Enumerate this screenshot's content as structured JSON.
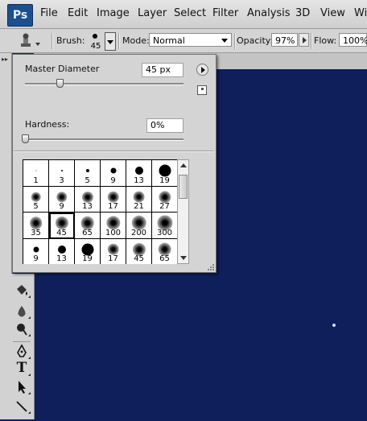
{
  "menubar": {
    "logo": "Ps",
    "items": [
      "File",
      "Edit",
      "Image",
      "Layer",
      "Select",
      "Filter",
      "Analysis",
      "3D",
      "View",
      "Wi"
    ]
  },
  "options_bar": {
    "brush_label": "Brush:",
    "brush_size": "45",
    "mode_label": "Mode:",
    "mode_value": "Normal",
    "opacity_label": "Opacity:",
    "opacity_value": "97%",
    "flow_label": "Flow:",
    "flow_value": "100%"
  },
  "brush_panel": {
    "master_diameter_label": "Master Diameter",
    "master_diameter_value": "45 px",
    "master_diameter_fraction": 0.22,
    "hardness_label": "Hardness:",
    "hardness_value": "0%",
    "hardness_fraction": 0.0,
    "selected_brush": "45",
    "presets": [
      {
        "size": "1",
        "style": "hard"
      },
      {
        "size": "3",
        "style": "hard"
      },
      {
        "size": "5",
        "style": "hard"
      },
      {
        "size": "9",
        "style": "hard"
      },
      {
        "size": "13",
        "style": "hard"
      },
      {
        "size": "19",
        "style": "hard"
      },
      {
        "size": "5",
        "style": "soft"
      },
      {
        "size": "9",
        "style": "soft"
      },
      {
        "size": "13",
        "style": "soft"
      },
      {
        "size": "17",
        "style": "soft"
      },
      {
        "size": "21",
        "style": "soft"
      },
      {
        "size": "27",
        "style": "soft"
      },
      {
        "size": "35",
        "style": "soft"
      },
      {
        "size": "45",
        "style": "soft"
      },
      {
        "size": "65",
        "style": "soft"
      },
      {
        "size": "100",
        "style": "soft"
      },
      {
        "size": "200",
        "style": "soft"
      },
      {
        "size": "300",
        "style": "soft"
      },
      {
        "size": "9",
        "style": "hard"
      },
      {
        "size": "13",
        "style": "hard"
      },
      {
        "size": "19",
        "style": "hard"
      },
      {
        "size": "17",
        "style": "soft"
      },
      {
        "size": "45",
        "style": "soft"
      },
      {
        "size": "65",
        "style": "soft"
      }
    ]
  },
  "tools": {
    "icons": [
      "paint-bucket-icon",
      "blur-drop-icon",
      "dodge-icon",
      "pen-tool-icon",
      "type-tool-icon",
      "path-selection-icon",
      "line-tool-icon"
    ],
    "type_glyph": "T"
  },
  "colors": {
    "canvas": "#0e1f5c",
    "ui_gray": "#d4d4d4",
    "ps_logo": "#1c4f8e"
  }
}
